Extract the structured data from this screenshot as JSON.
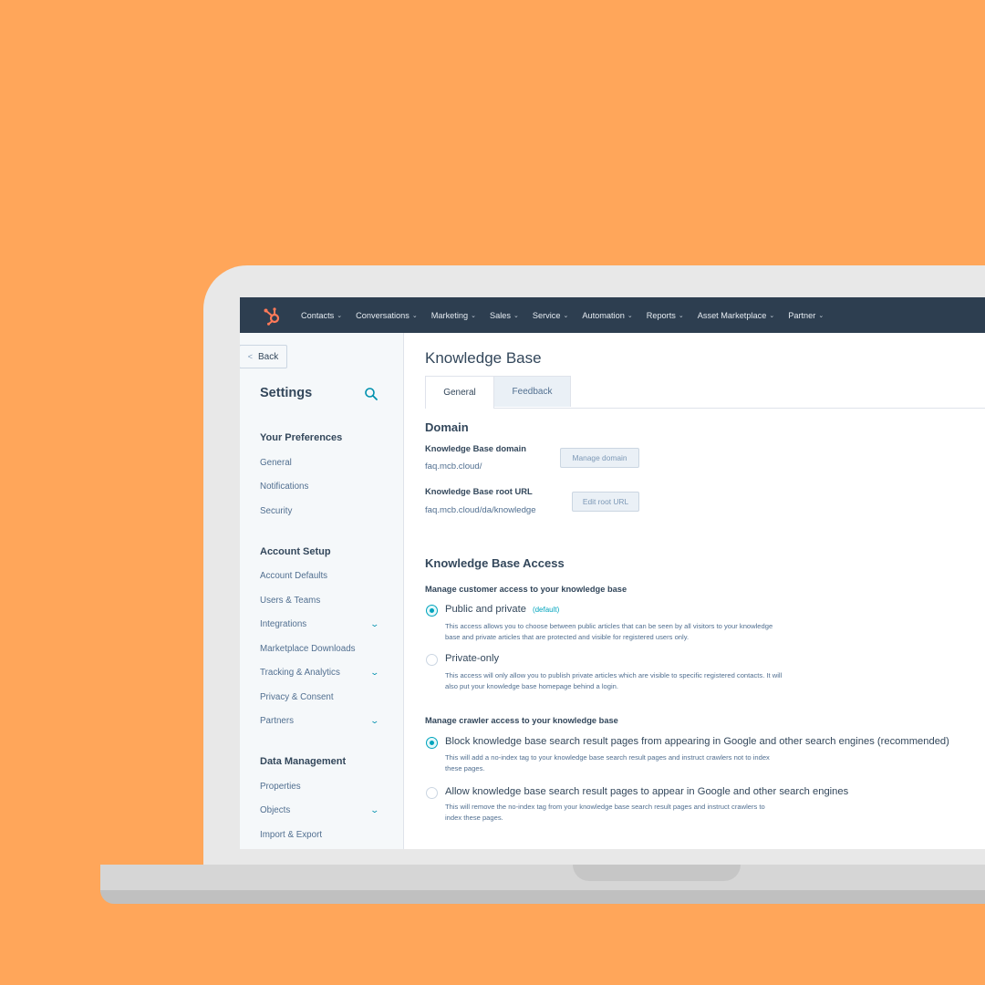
{
  "brand": {
    "accent": "#00A4BD",
    "logo_color": "#FF7A59",
    "nav_bg": "#2D3E50",
    "background": "#FFA65A"
  },
  "topnav": {
    "logo": "hubspot-sprocket-icon",
    "items": [
      {
        "label": "Contacts"
      },
      {
        "label": "Conversations"
      },
      {
        "label": "Marketing"
      },
      {
        "label": "Sales"
      },
      {
        "label": "Service"
      },
      {
        "label": "Automation"
      },
      {
        "label": "Reports"
      },
      {
        "label": "Asset Marketplace"
      },
      {
        "label": "Partner"
      }
    ],
    "chevron": "⌄"
  },
  "sidebar": {
    "back_label": "Back",
    "title": "Settings",
    "groups": [
      {
        "title": "Your Preferences",
        "items": [
          {
            "label": "General",
            "expandable": false
          },
          {
            "label": "Notifications",
            "expandable": false
          },
          {
            "label": "Security",
            "expandable": false
          }
        ]
      },
      {
        "title": "Account Setup",
        "items": [
          {
            "label": "Account Defaults",
            "expandable": false
          },
          {
            "label": "Users & Teams",
            "expandable": false
          },
          {
            "label": "Integrations",
            "expandable": true
          },
          {
            "label": "Marketplace Downloads",
            "expandable": false
          },
          {
            "label": "Tracking & Analytics",
            "expandable": true
          },
          {
            "label": "Privacy & Consent",
            "expandable": false
          },
          {
            "label": "Partners",
            "expandable": true
          }
        ]
      },
      {
        "title": "Data Management",
        "items": [
          {
            "label": "Properties",
            "expandable": false
          },
          {
            "label": "Objects",
            "expandable": true
          },
          {
            "label": "Import & Export",
            "expandable": false
          }
        ]
      }
    ]
  },
  "main": {
    "title": "Knowledge Base",
    "tabs": [
      {
        "label": "General",
        "active": true
      },
      {
        "label": "Feedback",
        "active": false
      }
    ],
    "domain": {
      "heading": "Domain",
      "kb_domain_label": "Knowledge Base domain",
      "kb_domain_value": "faq.mcb.cloud/",
      "manage_domain_button": "Manage domain",
      "root_url_label": "Knowledge Base root URL",
      "root_url_value": "faq.mcb.cloud/da/knowledge",
      "edit_root_url_button": "Edit root URL"
    },
    "access": {
      "heading": "Knowledge Base Access",
      "customer_subhead": "Manage customer access to your knowledge base",
      "customer_options": [
        {
          "label": "Public and private",
          "tag": "(default)",
          "checked": true,
          "desc1": "This access allows you to choose between public articles that can be seen by all visitors to your knowledge",
          "desc2": "base and private articles that are protected and visible for registered users only."
        },
        {
          "label": "Private-only",
          "tag": "",
          "checked": false,
          "desc1": "This access will only allow you to publish private articles which are visible to specific registered contacts. It will",
          "desc2": "also put your knowledge base homepage behind a login."
        }
      ],
      "crawler_subhead": "Manage crawler access to your knowledge base",
      "crawler_options": [
        {
          "label": "Block knowledge base search result pages from appearing in Google and other search engines (recommended)",
          "checked": true,
          "desc1": "This will add a no-index tag to your knowledge base search result pages and instruct crawlers not to index",
          "desc2": "these pages."
        },
        {
          "label": "Allow knowledge base search result pages to appear in Google and other search engines",
          "checked": false,
          "desc1": "This will remove the no-index tag from your knowledge base search result pages and instruct crawlers to",
          "desc2": "index these pages."
        }
      ]
    }
  }
}
